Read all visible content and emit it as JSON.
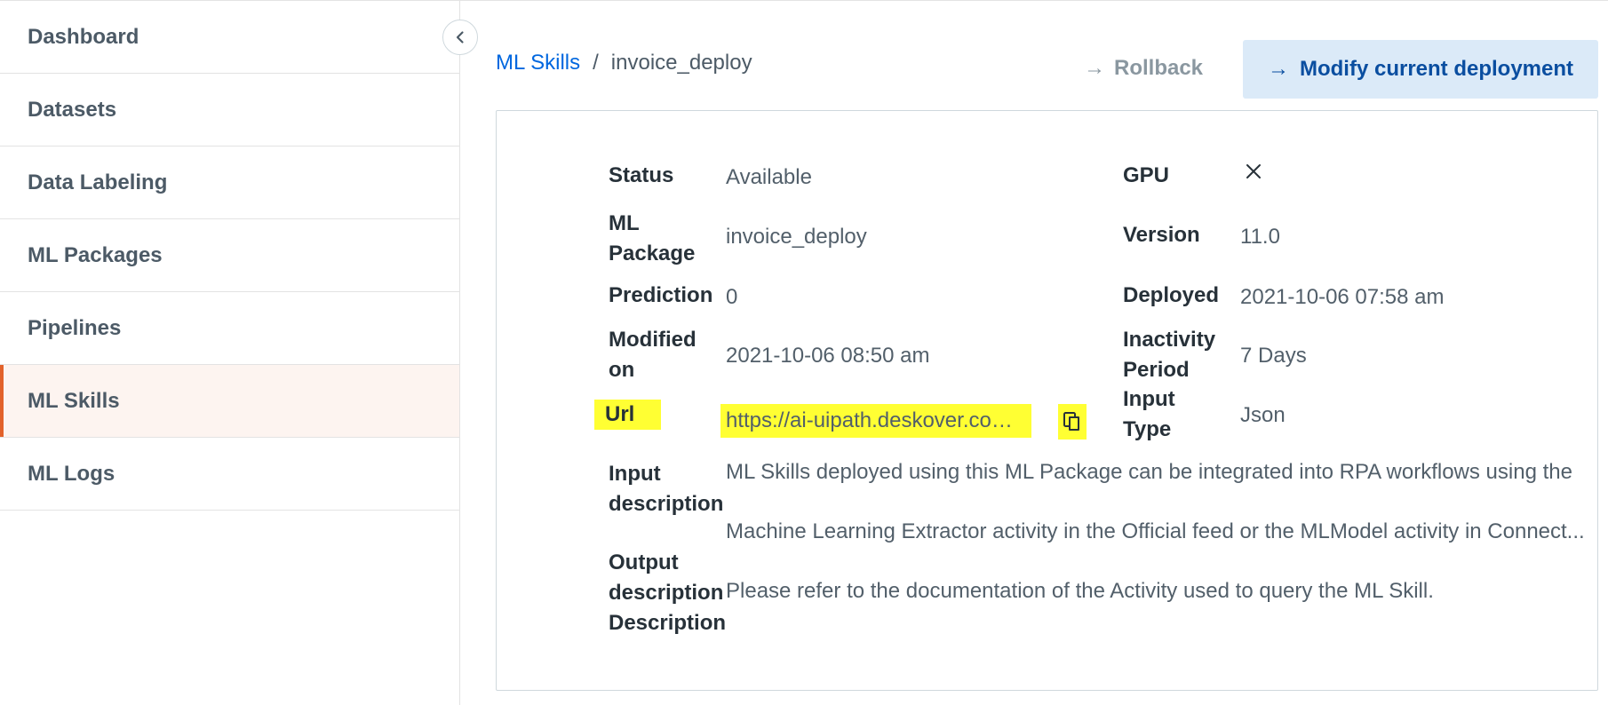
{
  "sidebar": {
    "items": [
      {
        "label": "Dashboard"
      },
      {
        "label": "Datasets"
      },
      {
        "label": "Data Labeling"
      },
      {
        "label": "ML Packages"
      },
      {
        "label": "Pipelines"
      },
      {
        "label": "ML Skills",
        "active": true
      },
      {
        "label": "ML Logs"
      }
    ]
  },
  "breadcrumb": {
    "parent": "ML Skills",
    "separator": "/",
    "current": "invoice_deploy"
  },
  "actions": {
    "rollback_label": "Rollback",
    "modify_label": "Modify current deployment"
  },
  "details": {
    "status": {
      "label": "Status",
      "value": "Available"
    },
    "gpu": {
      "label": "GPU",
      "value_icon": "close-icon"
    },
    "ml_package": {
      "label_line1": "ML",
      "label_line2": "Package",
      "value": "invoice_deploy"
    },
    "version": {
      "label": "Version",
      "value": "11.0"
    },
    "prediction": {
      "label": "Prediction",
      "value": "0"
    },
    "deployed": {
      "label": "Deployed",
      "value": "2021-10-06 07:58 am"
    },
    "modified_on": {
      "label_line1": "Modified",
      "label_line2": "on",
      "value": "2021-10-06 08:50 am"
    },
    "inactivity_period": {
      "label_line1": "Inactivity",
      "label_line2": "Period",
      "value": "7 Days"
    },
    "url": {
      "label": "Url",
      "value": "https://ai-uipath.deskover.com/..."
    },
    "input_type": {
      "label_line1": "Input",
      "label_line2": "Type",
      "value": "Json"
    },
    "input_description": {
      "label_line1": "Input",
      "label_line2": "description",
      "line1": "ML Skills deployed using this ML Package can be integrated into RPA workflows using the",
      "line2": "Machine Learning Extractor activity in the Official feed or the MLModel activity in Connect..."
    },
    "output_description": {
      "label_line1": "Output",
      "label_line2": "description",
      "label_line3": "Description",
      "value": "Please refer to the documentation of the Activity used to query the ML Skill."
    }
  },
  "colors": {
    "accent": "#e2622b",
    "link": "#0067df",
    "primary_button_bg": "#dbeaf8",
    "highlight": "#ffff33"
  }
}
